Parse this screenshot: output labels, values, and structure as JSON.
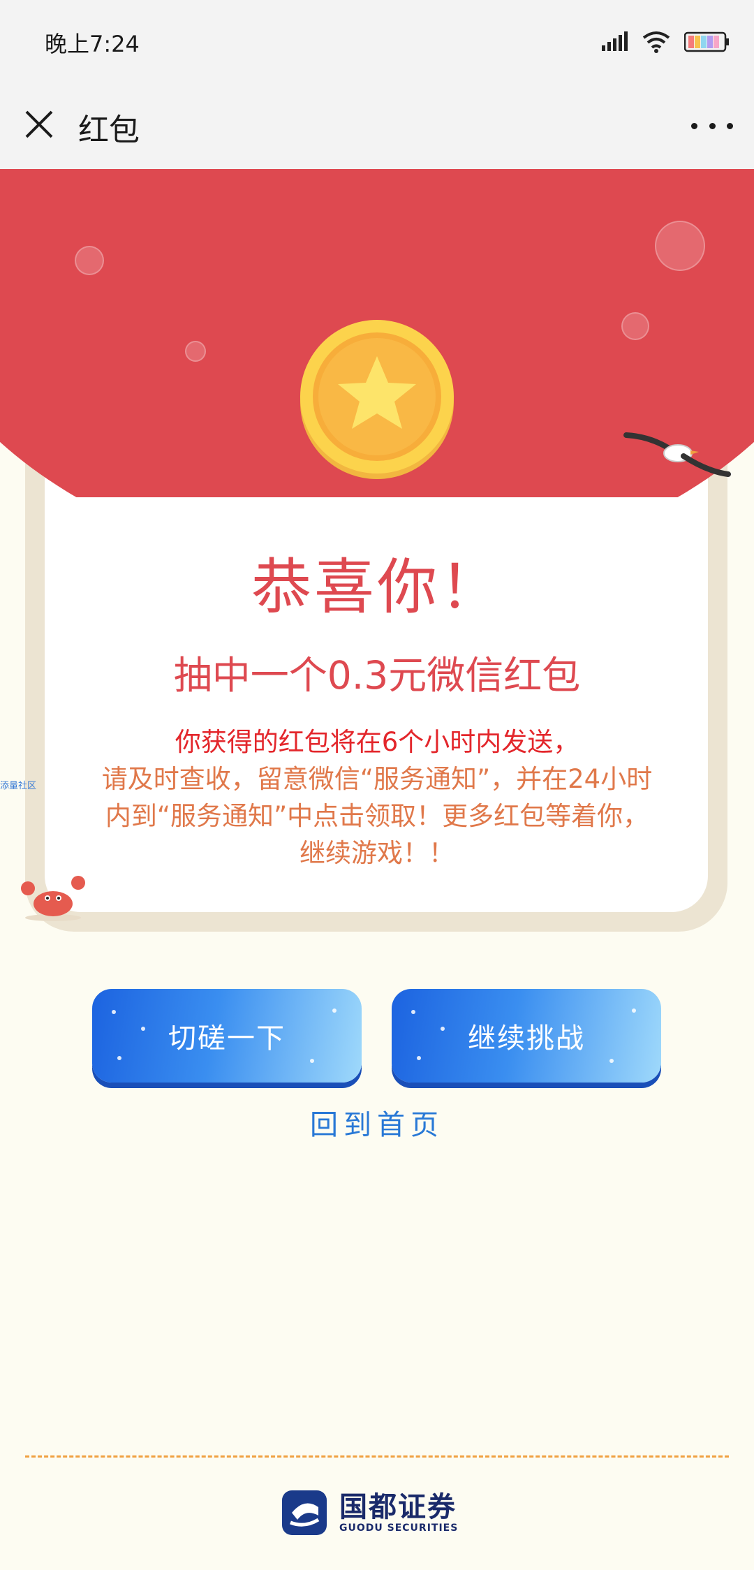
{
  "status_bar": {
    "time": "晚上7:24"
  },
  "nav": {
    "title": "红包"
  },
  "card": {
    "title": "恭喜你！",
    "prize": "抽中一个0.3元微信红包",
    "notice_highlight": "你获得的红包将在6个小时内发送，",
    "notice_line2": "请及时查收，留意微信“服务通知”，并在24小时",
    "notice_line3": "内到“服务通知”中点击领取！更多红包等着你，",
    "notice_line4": "继续游戏！！"
  },
  "side_label": "添量社区",
  "buttons": {
    "left": "切磋一下",
    "right": "继续挑战"
  },
  "home_link": "回到首页",
  "footer": {
    "logo_cn": "国都证券",
    "logo_en": "GUODU SECURITIES"
  },
  "colors": {
    "red": "#de4950",
    "blue_button": "#2a7de8",
    "link": "#2878d6",
    "background": "#fdfcf2"
  }
}
